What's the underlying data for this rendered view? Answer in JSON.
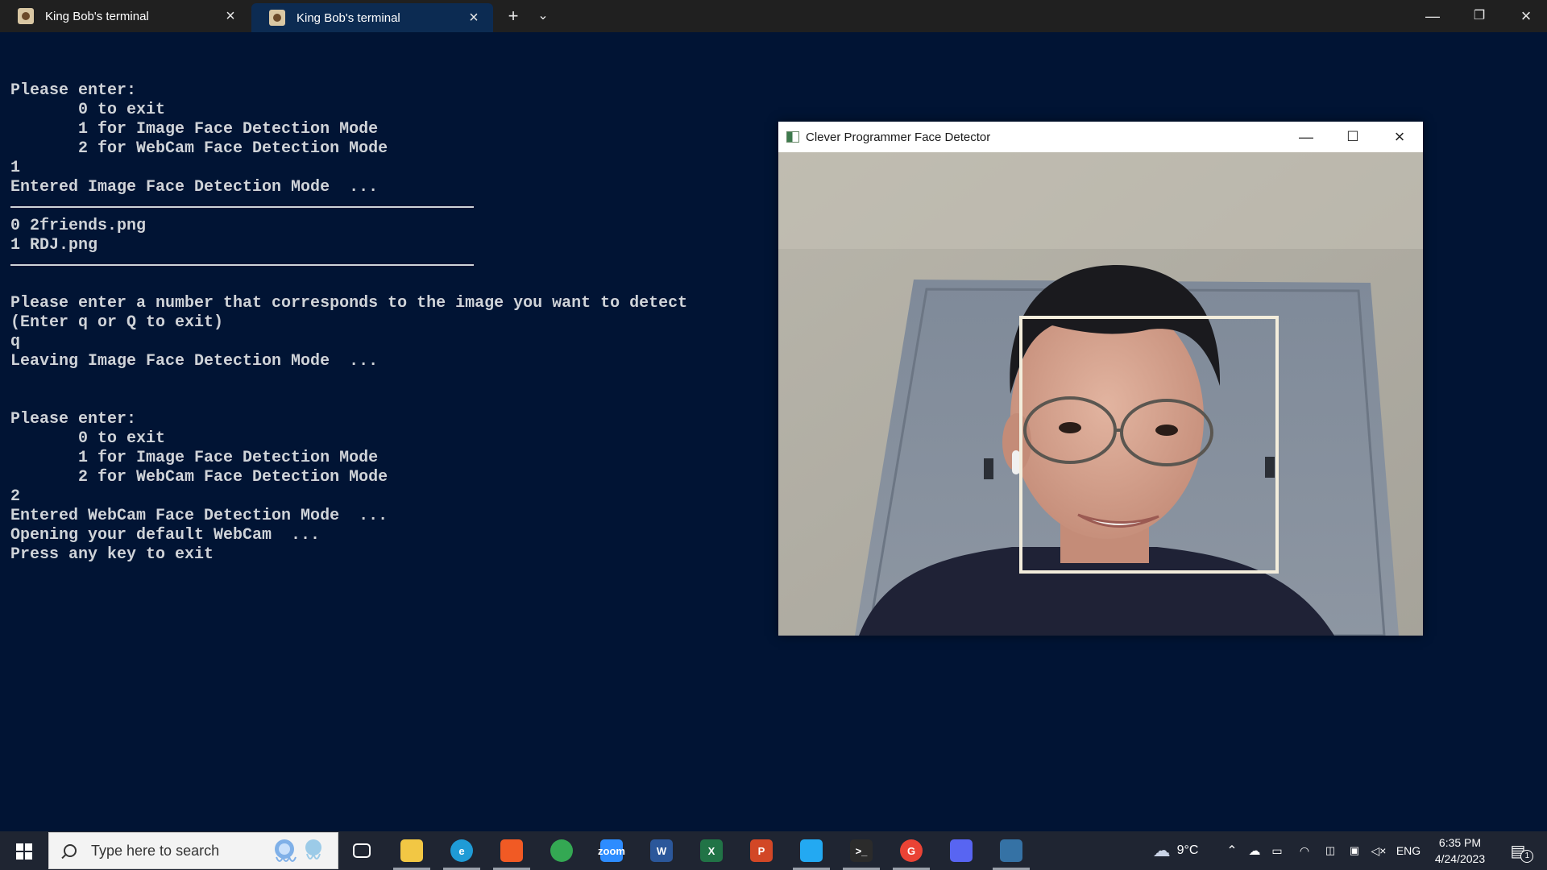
{
  "terminal_tabs": [
    {
      "label": "King Bob's terminal",
      "active": false
    },
    {
      "label": "King Bob's terminal",
      "active": true
    }
  ],
  "tabbar": {
    "new_tab": "+",
    "dropdown": "⌄"
  },
  "terminal_lines": [
    "",
    "Please enter:",
    "       0 to exit",
    "       1 for Image Face Detection Mode",
    "       2 for WebCam Face Detection Mode",
    "1",
    "Entered Image Face Detection Mode  ...",
    "---",
    "0 2friends.png",
    "1 RDJ.png",
    "---",
    "",
    "Please enter a number that corresponds to the image you want to detect",
    "(Enter q or Q to exit)",
    "q",
    "Leaving Image Face Detection Mode  ...",
    "",
    "",
    "Please enter:",
    "       0 to exit",
    "       1 for Image Face Detection Mode",
    "       2 for WebCam Face Detection Mode",
    "2",
    "Entered WebCam Face Detection Mode  ...",
    "Opening your default WebCam  ...",
    "Press any key to exit"
  ],
  "face_window": {
    "title": "Clever Programmer Face Detector"
  },
  "taskbar": {
    "search_placeholder": "Type here to search",
    "apps": [
      {
        "name": "task-view",
        "label": "",
        "color": "#1f2532",
        "open": false
      },
      {
        "name": "file-explorer",
        "label": "",
        "color": "#f2c744",
        "open": true
      },
      {
        "name": "edge",
        "label": "e",
        "color": "#1f9bd6",
        "open": true
      },
      {
        "name": "brave",
        "label": "",
        "color": "#f15a24",
        "open": true
      },
      {
        "name": "chrome",
        "label": "",
        "color": "#34a853",
        "open": false
      },
      {
        "name": "zoom",
        "label": "zoom",
        "color": "#2d8cff",
        "open": false
      },
      {
        "name": "word",
        "label": "W",
        "color": "#2b579a",
        "open": false
      },
      {
        "name": "excel",
        "label": "X",
        "color": "#217346",
        "open": false
      },
      {
        "name": "powerpoint",
        "label": "P",
        "color": "#d24726",
        "open": false
      },
      {
        "name": "vscode",
        "label": "",
        "color": "#23a9f2",
        "open": true
      },
      {
        "name": "terminal",
        "label": ">_",
        "color": "#2b2b2b",
        "open": true
      },
      {
        "name": "chrome-profile",
        "label": "G",
        "color": "#ea4335",
        "open": true
      },
      {
        "name": "discord",
        "label": "",
        "color": "#5865f2",
        "open": false
      },
      {
        "name": "python",
        "label": "",
        "color": "#3572a5",
        "open": true
      }
    ],
    "weather": "9°C",
    "language": "ENG",
    "time": "6:35 PM",
    "date": "4/24/2023",
    "notification_count": "1"
  },
  "detection": {
    "face_box_label": ""
  }
}
